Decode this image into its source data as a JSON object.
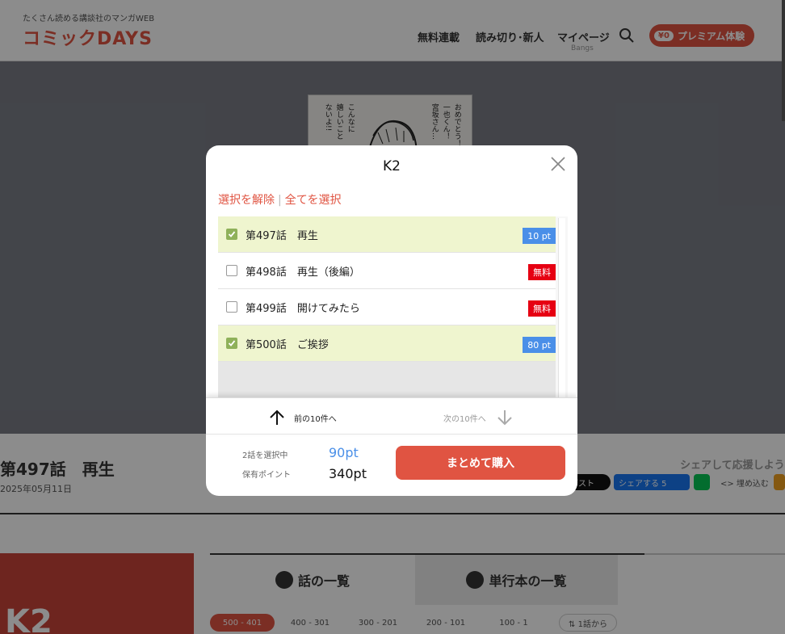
{
  "header": {
    "tagline": "たくさん読める講談社のマンガWEB",
    "logo": "コミックDAYS",
    "nav": [
      "無料連載",
      "読み切り･新人",
      "マイページ"
    ],
    "nav_sub": "Bangs",
    "premium": {
      "badge": "¥0",
      "label": "プレミアム体験"
    }
  },
  "reader": {
    "manga_lines": [
      "おめでとう！",
      "一也くん！",
      "宮坂さん…",
      "こんなに",
      "嬉しいこと",
      "ないよ!!"
    ]
  },
  "episode": {
    "title": "第497話　再生",
    "date": "2025年05月11日",
    "share_heading": "シェアして応援しよう",
    "share_buttons": [
      "ポスト",
      "シェアする 5",
      "",
      "<> 埋め込む"
    ]
  },
  "list_section": {
    "cover_text": "K2",
    "tabs": [
      "話の一覧",
      "単行本の一覧"
    ],
    "ranges": [
      "500 - 401",
      "400 - 301",
      "300 - 201",
      "200 - 101",
      "100 - 1",
      "⇅ 1話から"
    ]
  },
  "modal": {
    "title": "K2",
    "deselect": "選択を解除",
    "separator": "|",
    "select_all": "全てを選択",
    "episodes": [
      {
        "name": "第497話　再生",
        "badge": "10 pt",
        "badge_type": "pt",
        "checked": true
      },
      {
        "name": "第498話　再生（後編）",
        "badge": "無料",
        "badge_type": "free",
        "checked": false
      },
      {
        "name": "第499話　開けてみたら",
        "badge": "無料",
        "badge_type": "free",
        "checked": false
      },
      {
        "name": "第500話　ご挨拶",
        "badge": "80 pt",
        "badge_type": "pt",
        "checked": true
      }
    ],
    "prev": "前の10件へ",
    "next": "次の10件へ",
    "selected_label": "2話を選択中",
    "selected_value": "90pt",
    "points_label": "保有ポイント",
    "points_value": "340pt",
    "buy": "まとめて購入"
  },
  "colors": {
    "accent": "#e05442",
    "badge_pt": "#4a8fe8",
    "badge_free": "#e60012",
    "selected_row": "#eff5cf",
    "checkbox": "#8fb15a",
    "price": "#4a8fe8"
  }
}
